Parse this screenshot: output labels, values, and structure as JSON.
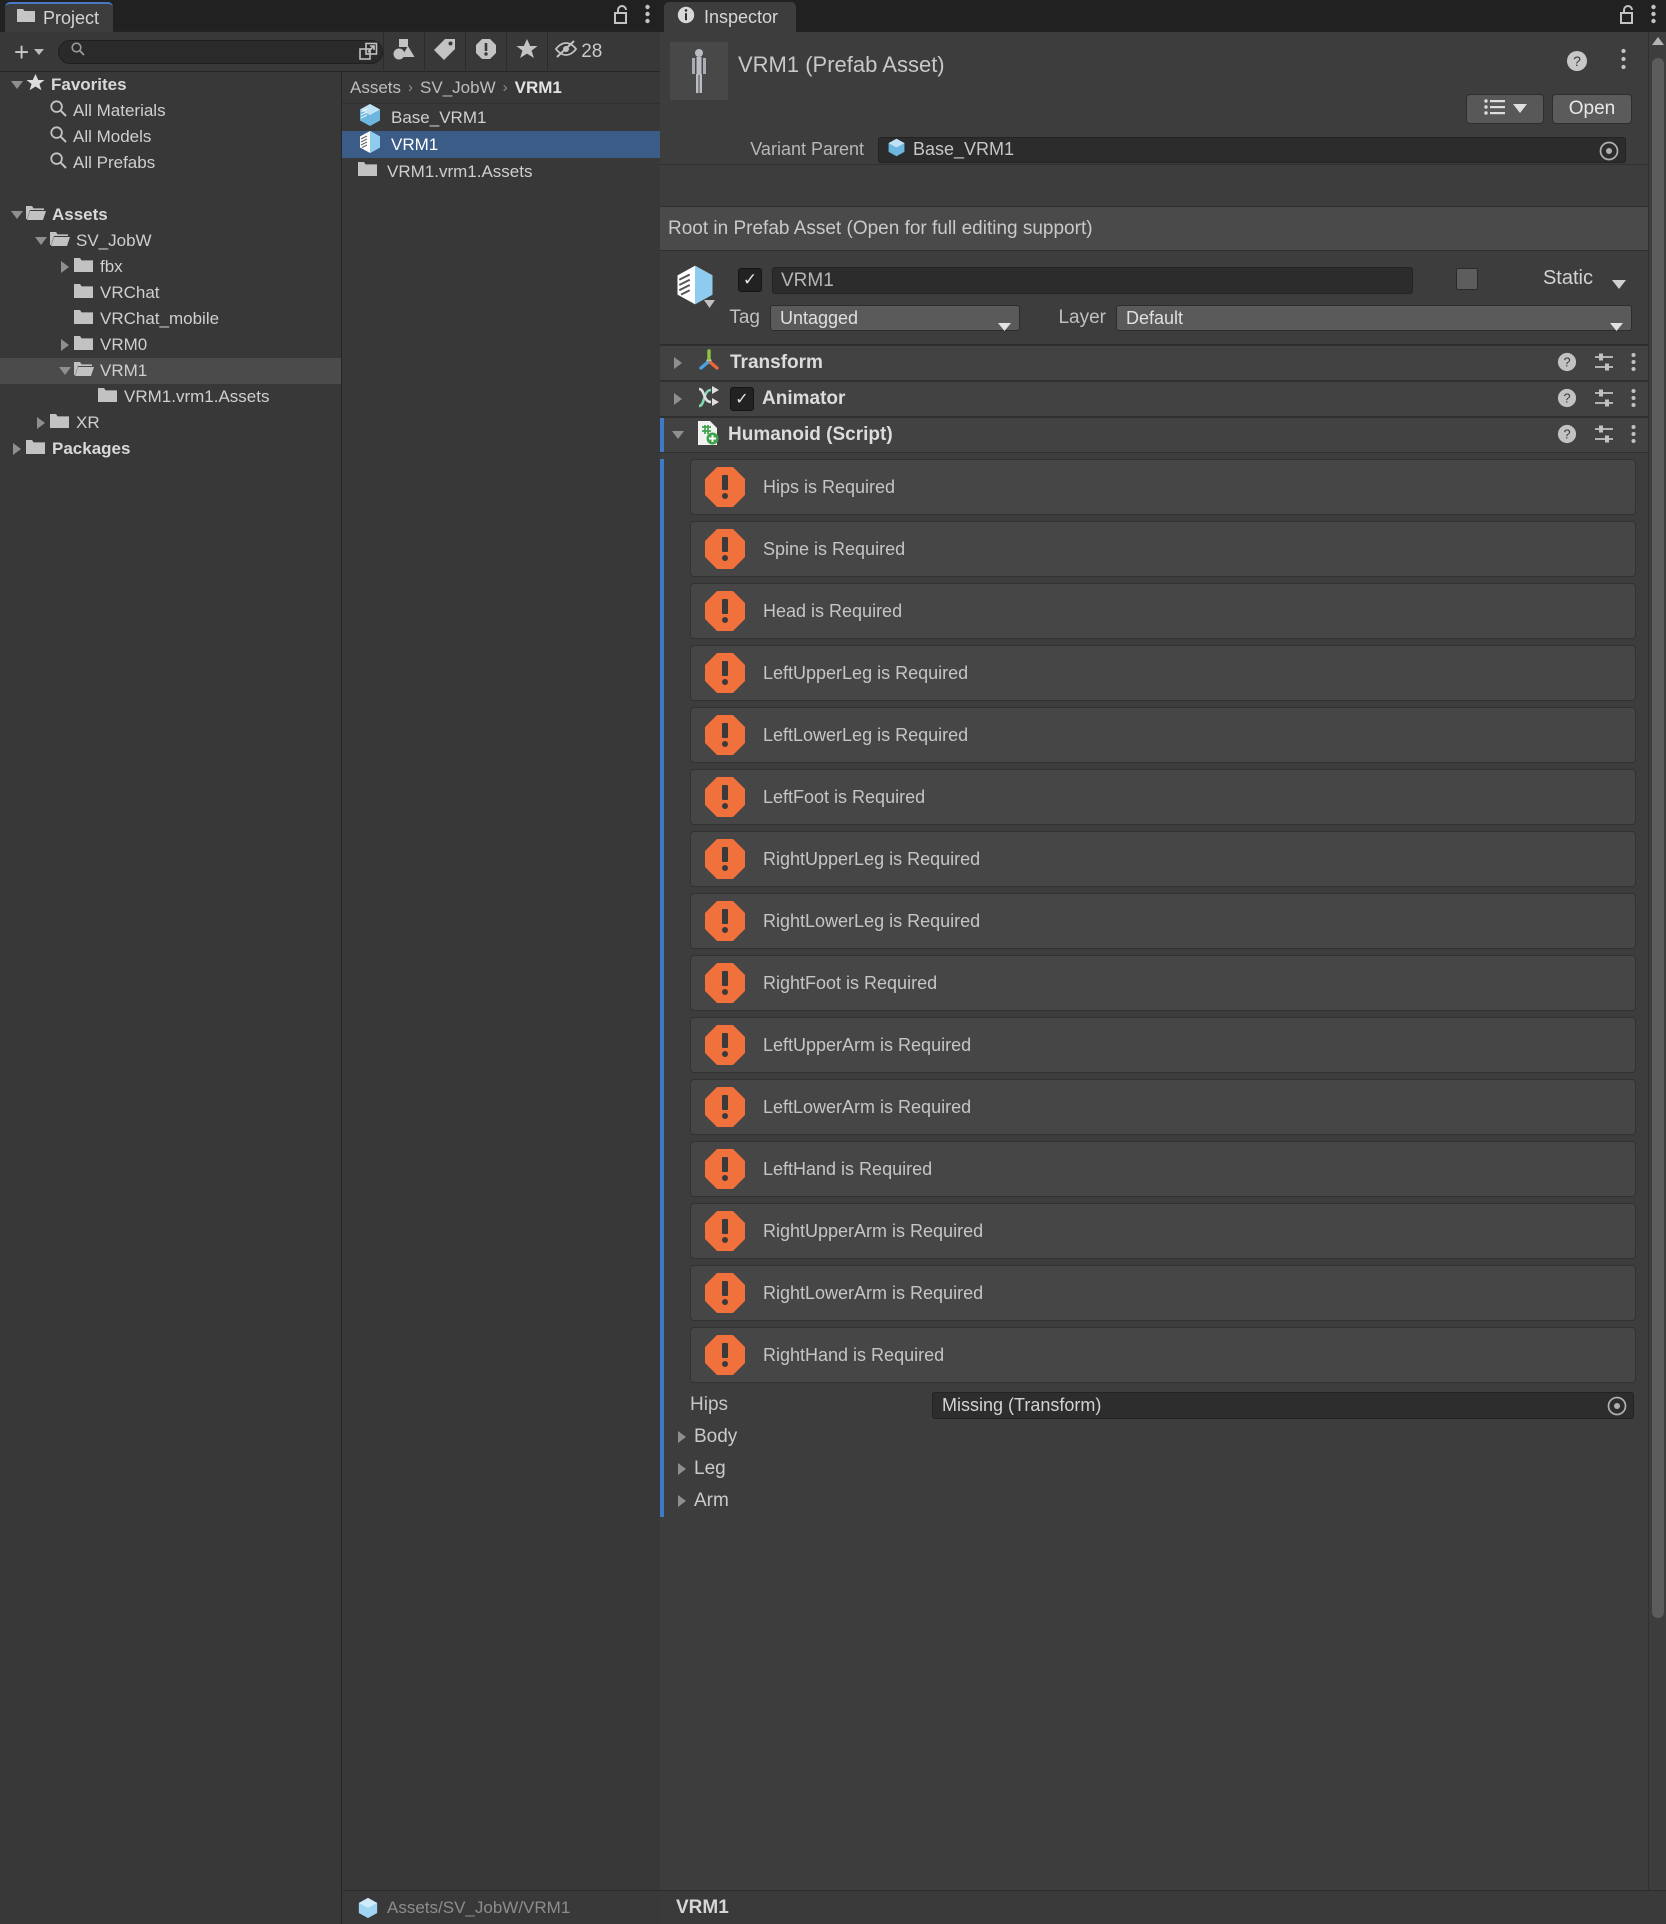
{
  "project": {
    "tab_label": "Project",
    "tab_icon": "folder-icon",
    "lock_icon": "lock-open-icon",
    "kebab_icon": "kebab-menu-icon",
    "toolbar": {
      "create_label": "+",
      "create_caret_icon": "chevron-down-icon",
      "search_placeholder": "",
      "search_value": "",
      "search_icon": "search-icon",
      "search_expand_icon": "open-in-new-icon",
      "filter_type_icon": "shapes-filter-icon",
      "filter_label_icon": "tag-filter-icon",
      "filter_warning_icon": "warning-filter-icon",
      "favorite_icon": "star-icon",
      "hidden_icon": "eye-slash-icon",
      "hidden_count": "28"
    },
    "tree": [
      {
        "indent": 0,
        "twisty": "down",
        "icon": "star-icon",
        "label": "Favorites",
        "bold": true,
        "selected": false
      },
      {
        "indent": 1,
        "twisty": "none",
        "icon": "search-icon",
        "label": "All Materials",
        "bold": false,
        "selected": false
      },
      {
        "indent": 1,
        "twisty": "none",
        "icon": "search-icon",
        "label": "All Models",
        "bold": false,
        "selected": false
      },
      {
        "indent": 1,
        "twisty": "none",
        "icon": "search-icon",
        "label": "All Prefabs",
        "bold": false,
        "selected": false
      },
      {
        "indent": 0,
        "twisty": "none",
        "icon": "none",
        "label": "",
        "bold": false,
        "selected": false
      },
      {
        "indent": 0,
        "twisty": "down",
        "icon": "folder-open-icon",
        "label": "Assets",
        "bold": true,
        "selected": false
      },
      {
        "indent": 1,
        "twisty": "down",
        "icon": "folder-open-icon",
        "label": "SV_JobW",
        "bold": false,
        "selected": false
      },
      {
        "indent": 2,
        "twisty": "right",
        "icon": "folder-icon",
        "label": "fbx",
        "bold": false,
        "selected": false
      },
      {
        "indent": 2,
        "twisty": "none",
        "icon": "folder-icon",
        "label": "VRChat",
        "bold": false,
        "selected": false
      },
      {
        "indent": 2,
        "twisty": "none",
        "icon": "folder-icon",
        "label": "VRChat_mobile",
        "bold": false,
        "selected": false
      },
      {
        "indent": 2,
        "twisty": "right",
        "icon": "folder-icon",
        "label": "VRM0",
        "bold": false,
        "selected": false
      },
      {
        "indent": 2,
        "twisty": "down",
        "icon": "folder-open-icon",
        "label": "VRM1",
        "bold": false,
        "selected": true
      },
      {
        "indent": 3,
        "twisty": "none",
        "icon": "folder-icon",
        "label": "VRM1.vrm1.Assets",
        "bold": false,
        "selected": false
      },
      {
        "indent": 1,
        "twisty": "right",
        "icon": "folder-icon",
        "label": "XR",
        "bold": false,
        "selected": false
      },
      {
        "indent": 0,
        "twisty": "right",
        "icon": "folder-icon",
        "label": "Packages",
        "bold": true,
        "selected": false
      }
    ],
    "breadcrumb": [
      "Assets",
      "SV_JobW",
      "VRM1"
    ],
    "files": [
      {
        "label": "Base_VRM1",
        "icon": "prefab-blue-icon",
        "selected": false
      },
      {
        "label": "VRM1",
        "icon": "prefab-variant-icon",
        "selected": true
      },
      {
        "label": "VRM1.vrm1.Assets",
        "icon": "folder-icon",
        "selected": false
      }
    ],
    "status_path": "Assets/SV_JobW/VRM1"
  },
  "inspector": {
    "tab_label": "Inspector",
    "tab_icon": "info-icon",
    "lock_icon": "lock-open-icon",
    "kebab_icon": "kebab-menu-icon",
    "asset_title": "VRM1 (Prefab Asset)",
    "thumbnail_icon": "avatar-preview-icon",
    "help_icon": "help-icon",
    "menu_icon": "kebab-menu-icon",
    "layout_button_icon": "list-layout-icon",
    "layout_caret_icon": "chevron-down-icon",
    "open_button": "Open",
    "variant_parent_label": "Variant Parent",
    "variant_parent_value": "Base_VRM1",
    "variant_parent_icon": "prefab-blue-icon",
    "picker_icon": "object-picker-icon",
    "root_note": "Root in Prefab Asset (Open for full editing support)",
    "gameobject": {
      "icon": "prefab-variant-icon",
      "enabled_checkbox": "✓",
      "name": "VRM1",
      "static_label": "Static",
      "static_caret_icon": "chevron-down-icon",
      "tag_label": "Tag",
      "tag_value": "Untagged",
      "layer_label": "Layer",
      "layer_value": "Default"
    },
    "components": [
      {
        "name": "Transform",
        "icon": "transform-icon",
        "expanded": false,
        "has_checkbox": false,
        "selected": false
      },
      {
        "name": "Animator",
        "icon": "animator-icon",
        "expanded": false,
        "has_checkbox": true,
        "checked": true,
        "selected": false
      },
      {
        "name": "Humanoid (Script)",
        "icon": "script-icon",
        "expanded": true,
        "has_checkbox": false,
        "selected": true
      }
    ],
    "component_icons": {
      "help": "help-icon",
      "preset": "preset-icon",
      "menu": "kebab-menu-icon"
    },
    "warnings": [
      "Hips is Required",
      "Spine is Required",
      "Head is Required",
      "LeftUpperLeg is Required",
      "LeftLowerLeg is Required",
      "LeftFoot is Required",
      "RightUpperLeg is Required",
      "RightLowerLeg is Required",
      "RightFoot is Required",
      "LeftUpperArm is Required",
      "LeftLowerArm is Required",
      "LeftHand is Required",
      "RightUpperArm is Required",
      "RightLowerArm is Required",
      "RightHand is Required"
    ],
    "warning_icon": "warning-octagon-icon",
    "properties": [
      {
        "label": "Hips",
        "type": "object",
        "value": "Missing (Transform)"
      },
      {
        "label": "Body",
        "type": "foldout"
      },
      {
        "label": "Leg",
        "type": "foldout"
      },
      {
        "label": "Arm",
        "type": "foldout"
      }
    ],
    "footer_name": "VRM1",
    "scrollbar": {
      "up_icon": "triangle-up-icon",
      "down_icon": "triangle-down-icon"
    }
  },
  "colors": {
    "accent_blue": "#3e7ac7",
    "selection_blue": "#3c5c88",
    "warning_orange": "#f0713c",
    "panel_bg": "#383838",
    "inspector_bg": "#3d3d3d"
  }
}
